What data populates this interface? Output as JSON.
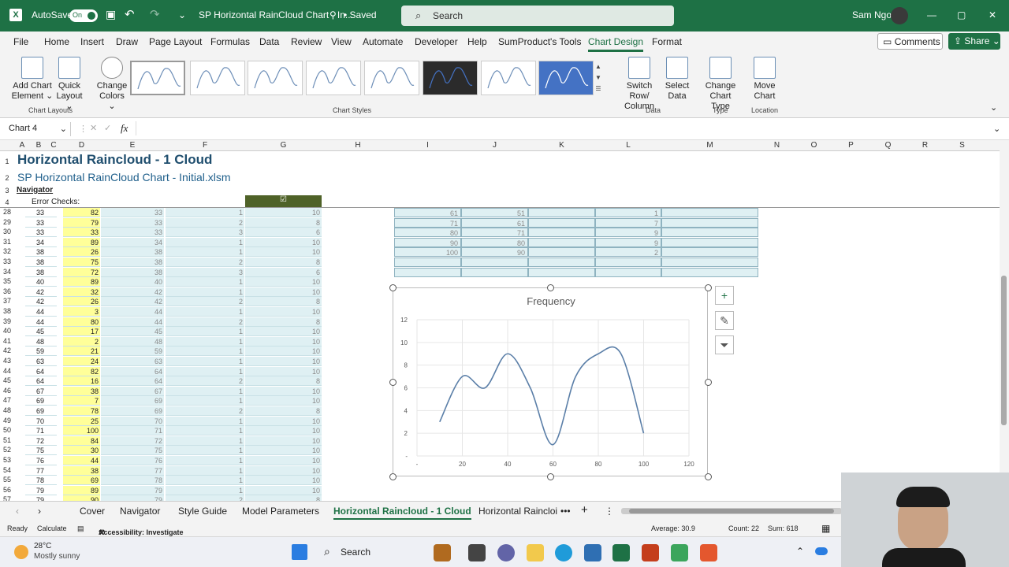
{
  "titlebar": {
    "autosave": "AutoSave",
    "toggle": "On",
    "doc": "SP Horizontal RainCloud Chart - In...",
    "saved": "• Saved",
    "search": "Search",
    "user": "Sam Ngo"
  },
  "menu": [
    "File",
    "Home",
    "Insert",
    "Draw",
    "Page Layout",
    "Formulas",
    "Data",
    "Review",
    "View",
    "Automate",
    "Developer",
    "Help",
    "SumProduct's Tools",
    "Chart Design",
    "Format"
  ],
  "menu_right": {
    "comments": "Comments",
    "share": "Share"
  },
  "ribbon": {
    "add_chart": "Add Chart",
    "add_chart2": "Element",
    "quick": "Quick",
    "quick2": "Layout",
    "change": "Change",
    "change2": "Colors",
    "switch": "Switch Row/",
    "switch2": "Column",
    "select": "Select",
    "select2": "Data",
    "ctype": "Change",
    "ctype2": "Chart Type",
    "move": "Move",
    "move2": "Chart",
    "groups": {
      "layouts": "Chart Layouts",
      "styles": "Chart Styles",
      "data": "Data",
      "type": "Type",
      "location": "Location"
    }
  },
  "formula": {
    "namebox": "Chart 4",
    "fx": "fx"
  },
  "columns": [
    "A",
    "B",
    "C",
    "D",
    "E",
    "F",
    "G",
    "H",
    "I",
    "J",
    "K",
    "L",
    "M",
    "N",
    "O",
    "P",
    "Q",
    "R",
    "S"
  ],
  "sheet": {
    "title": "Horizontal Raincloud - 1 Cloud",
    "subtitle": "SP Horizontal RainCloud Chart - Initial.xlsm",
    "navigator": "Navigator",
    "error_checks": "Error Checks:",
    "check": "☑"
  },
  "header_rows": [
    "1",
    "2",
    "3",
    "4"
  ],
  "rows": [
    [
      "28",
      "33",
      "82",
      "33",
      "1",
      "10"
    ],
    [
      "29",
      "33",
      "79",
      "33",
      "2",
      "8"
    ],
    [
      "30",
      "33",
      "33",
      "33",
      "3",
      "6"
    ],
    [
      "31",
      "34",
      "89",
      "34",
      "1",
      "10"
    ],
    [
      "32",
      "38",
      "26",
      "38",
      "1",
      "10"
    ],
    [
      "33",
      "38",
      "75",
      "38",
      "2",
      "8"
    ],
    [
      "34",
      "38",
      "72",
      "38",
      "3",
      "6"
    ],
    [
      "35",
      "40",
      "89",
      "40",
      "1",
      "10"
    ],
    [
      "36",
      "42",
      "32",
      "42",
      "1",
      "10"
    ],
    [
      "37",
      "42",
      "26",
      "42",
      "2",
      "8"
    ],
    [
      "38",
      "44",
      "3",
      "44",
      "1",
      "10"
    ],
    [
      "39",
      "44",
      "80",
      "44",
      "2",
      "8"
    ],
    [
      "40",
      "45",
      "17",
      "45",
      "1",
      "10"
    ],
    [
      "41",
      "48",
      "2",
      "48",
      "1",
      "10"
    ],
    [
      "42",
      "59",
      "21",
      "59",
      "1",
      "10"
    ],
    [
      "43",
      "63",
      "24",
      "63",
      "1",
      "10"
    ],
    [
      "44",
      "64",
      "82",
      "64",
      "1",
      "10"
    ],
    [
      "45",
      "64",
      "16",
      "64",
      "2",
      "8"
    ],
    [
      "46",
      "67",
      "38",
      "67",
      "1",
      "10"
    ],
    [
      "47",
      "69",
      "7",
      "69",
      "1",
      "10"
    ],
    [
      "48",
      "69",
      "78",
      "69",
      "2",
      "8"
    ],
    [
      "49",
      "70",
      "25",
      "70",
      "1",
      "10"
    ],
    [
      "50",
      "71",
      "100",
      "71",
      "1",
      "10"
    ],
    [
      "51",
      "72",
      "84",
      "72",
      "1",
      "10"
    ],
    [
      "52",
      "75",
      "30",
      "75",
      "1",
      "10"
    ],
    [
      "53",
      "76",
      "44",
      "76",
      "1",
      "10"
    ],
    [
      "54",
      "77",
      "38",
      "77",
      "1",
      "10"
    ],
    [
      "55",
      "78",
      "69",
      "78",
      "1",
      "10"
    ],
    [
      "56",
      "79",
      "89",
      "79",
      "1",
      "10"
    ],
    [
      "57",
      "79",
      "90",
      "79",
      "2",
      "8"
    ]
  ],
  "freq_table": [
    [
      "61",
      "51",
      "1"
    ],
    [
      "71",
      "61",
      "7"
    ],
    [
      "80",
      "71",
      "9"
    ],
    [
      "90",
      "80",
      "9"
    ],
    [
      "100",
      "90",
      "2"
    ]
  ],
  "chart_data": {
    "type": "line",
    "title": "Frequency",
    "x": [
      10,
      20,
      30,
      40,
      50,
      60,
      70,
      80,
      90,
      100
    ],
    "values": [
      3,
      7,
      6,
      9,
      6,
      1,
      7,
      9,
      9,
      2
    ],
    "xticks": [
      "-",
      "20",
      "40",
      "60",
      "80",
      "100",
      "120"
    ],
    "yticks": [
      "-",
      "2",
      "4",
      "6",
      "8",
      "10",
      "12"
    ],
    "xlim": [
      0,
      120
    ],
    "ylim": [
      0,
      12
    ],
    "grid": true,
    "color": "#5b7fa8"
  },
  "tabs": [
    "Cover",
    "Navigator",
    "Style Guide",
    "Model Parameters",
    "Horizontal Raincloud - 1 Cloud",
    "Horizontal Raincloi"
  ],
  "status": {
    "ready": "Ready",
    "calc": "Calculate",
    "access": "Accessibility: Investigate",
    "avg": "Average: 30.9",
    "count": "Count: 22",
    "sum": "Sum: 618"
  },
  "taskbar": {
    "temp": "28°C",
    "weather": "Mostly sunny",
    "search": "Search"
  }
}
